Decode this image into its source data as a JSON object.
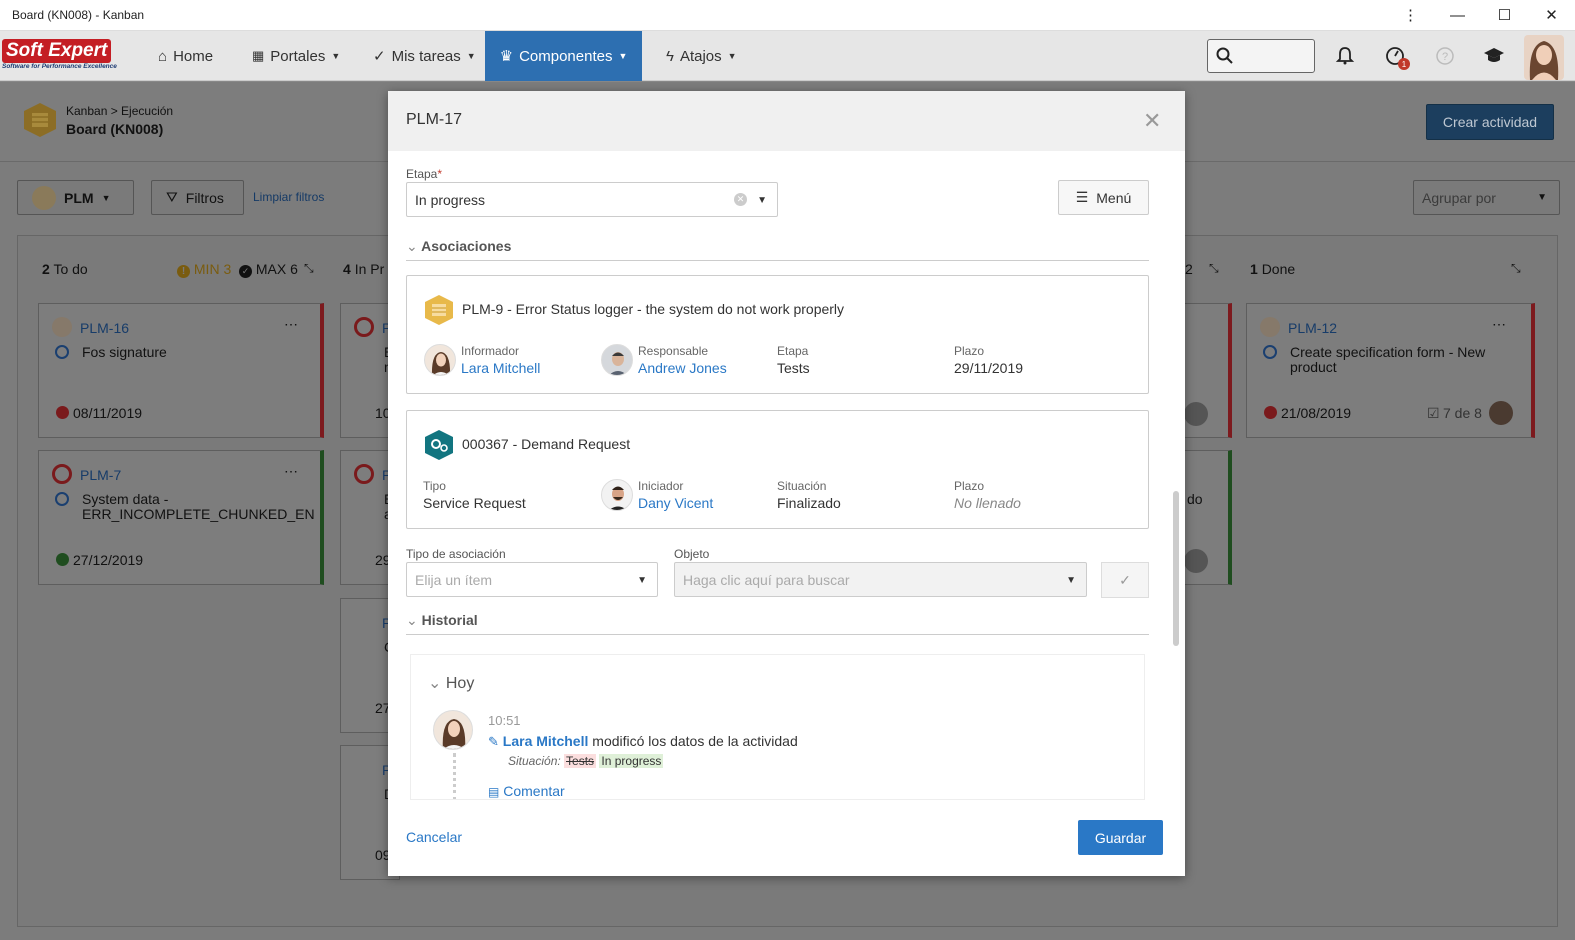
{
  "window": {
    "title": "Board (KN008) - Kanban"
  },
  "navbar": {
    "logo_text": "Soft Expert",
    "logo_tagline": "Software for Performance Excellence",
    "items": [
      {
        "label": "Home",
        "icon": "home-icon"
      },
      {
        "label": "Portales",
        "icon": "grid-icon"
      },
      {
        "label": "Mis tareas",
        "icon": "check-icon"
      },
      {
        "label": "Componentes",
        "icon": "trophy-icon"
      },
      {
        "label": "Atajos",
        "icon": "bolt-icon"
      }
    ],
    "notif_badge": "1"
  },
  "header": {
    "breadcrumb": "Kanban > Ejecución",
    "board_name": "Board (KN008)",
    "create_label": "Crear actividad"
  },
  "filters": {
    "plm_label": "PLM",
    "filters_label": "Filtros",
    "clear_label": "Limpiar filtros",
    "group_by_placeholder": "Agrupar por"
  },
  "columns": {
    "todo": {
      "count": "2",
      "name": "To do",
      "min": "MIN 3",
      "max": "MAX 6"
    },
    "inprogress": {
      "count": "4",
      "name": "In Pr"
    },
    "hidden": {
      "partial": "2"
    },
    "done": {
      "count": "1",
      "name": "Done"
    }
  },
  "cards": {
    "plm16": {
      "id": "PLM-16",
      "title": "Fos signature",
      "date": "08/11/2019"
    },
    "plm7": {
      "id": "PLM-7",
      "title_l1": "System data -",
      "title_l2": "ERR_INCOMPLETE_CHUNKED_EN",
      "date": "27/12/2019"
    },
    "plm12": {
      "id": "PLM-12",
      "title_l1": "Create specification form - New",
      "title_l2": "product",
      "date": "21/08/2019",
      "progress": "7 de 8"
    },
    "ip1": {
      "id": "P",
      "title": "E",
      "title2": "n",
      "date": "10"
    },
    "ip2": {
      "id": "P",
      "title": "E",
      "title2": "a",
      "date": "29"
    },
    "ip3": {
      "id": "P",
      "title": "C",
      "date": "27"
    },
    "ip4": {
      "id": "P",
      "title": "D",
      "date": "09"
    },
    "col3b": {
      "title": "do"
    }
  },
  "modal": {
    "title": "PLM-17",
    "stage_label": "Etapa",
    "stage_required": "*",
    "stage_value": "In progress",
    "menu_label": "Menú",
    "assoc_section": "Asociaciones",
    "assoc1": {
      "title": "PLM-9 - Error Status logger - the system do not work properly",
      "informer_label": "Informador",
      "informer": "Lara Mitchell",
      "responsible_label": "Responsable",
      "responsible": "Andrew Jones",
      "stage_label": "Etapa",
      "stage": "Tests",
      "deadline_label": "Plazo",
      "deadline": "29/11/2019"
    },
    "assoc2": {
      "title": "000367 - Demand Request",
      "type_label": "Tipo",
      "type": "Service Request",
      "initiator_label": "Iniciador",
      "initiator": "Dany Vicent",
      "status_label": "Situación",
      "status": "Finalizado",
      "deadline_label": "Plazo",
      "deadline": "No llenado"
    },
    "assoc_type_label": "Tipo de asociación",
    "assoc_type_placeholder": "Elija un ítem",
    "object_label": "Objeto",
    "object_placeholder": "Haga clic aquí para buscar",
    "history_section": "Historial",
    "history": {
      "day": "Hoy",
      "time": "10:51",
      "user": "Lara Mitchell",
      "action": "modificó los datos de la actividad",
      "field": "Situación:",
      "old": "Tests",
      "new": "In progress",
      "comment": "Comentar"
    },
    "cancel_label": "Cancelar",
    "save_label": "Guardar"
  }
}
